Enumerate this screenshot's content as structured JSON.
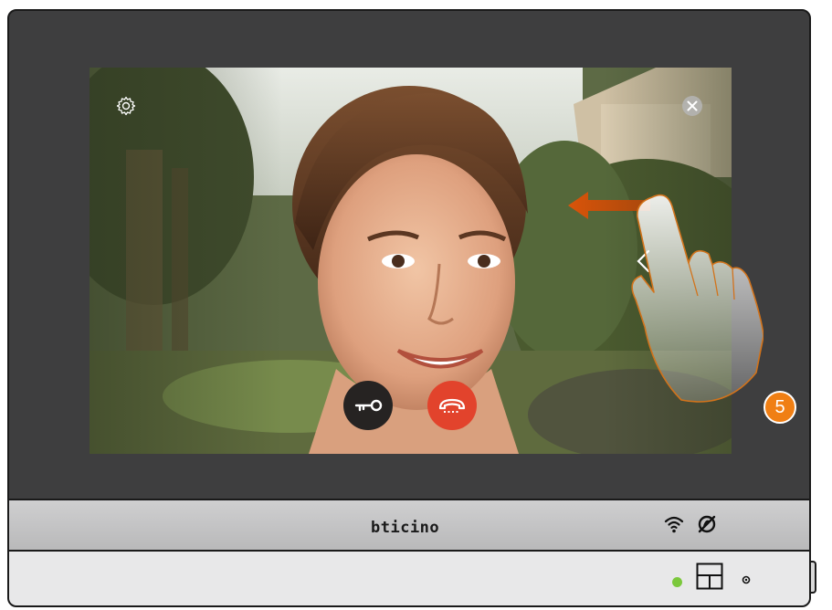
{
  "device": {
    "brand_logo": "bticino",
    "step_number": "5"
  },
  "screen": {
    "settings_icon": "gear-icon",
    "close_icon": "close-icon",
    "back_icon": "chevron-left-icon",
    "door_lock_icon": "key-icon",
    "end_call_icon": "hang-up-icon"
  },
  "status": {
    "wifi_icon": "wifi-icon",
    "do_not_disturb_icon": "do-not-disturb-icon",
    "led_color": "#7bc83c"
  },
  "colors": {
    "accent_orange": "#f07f14",
    "hangup_red": "#e2432c"
  }
}
